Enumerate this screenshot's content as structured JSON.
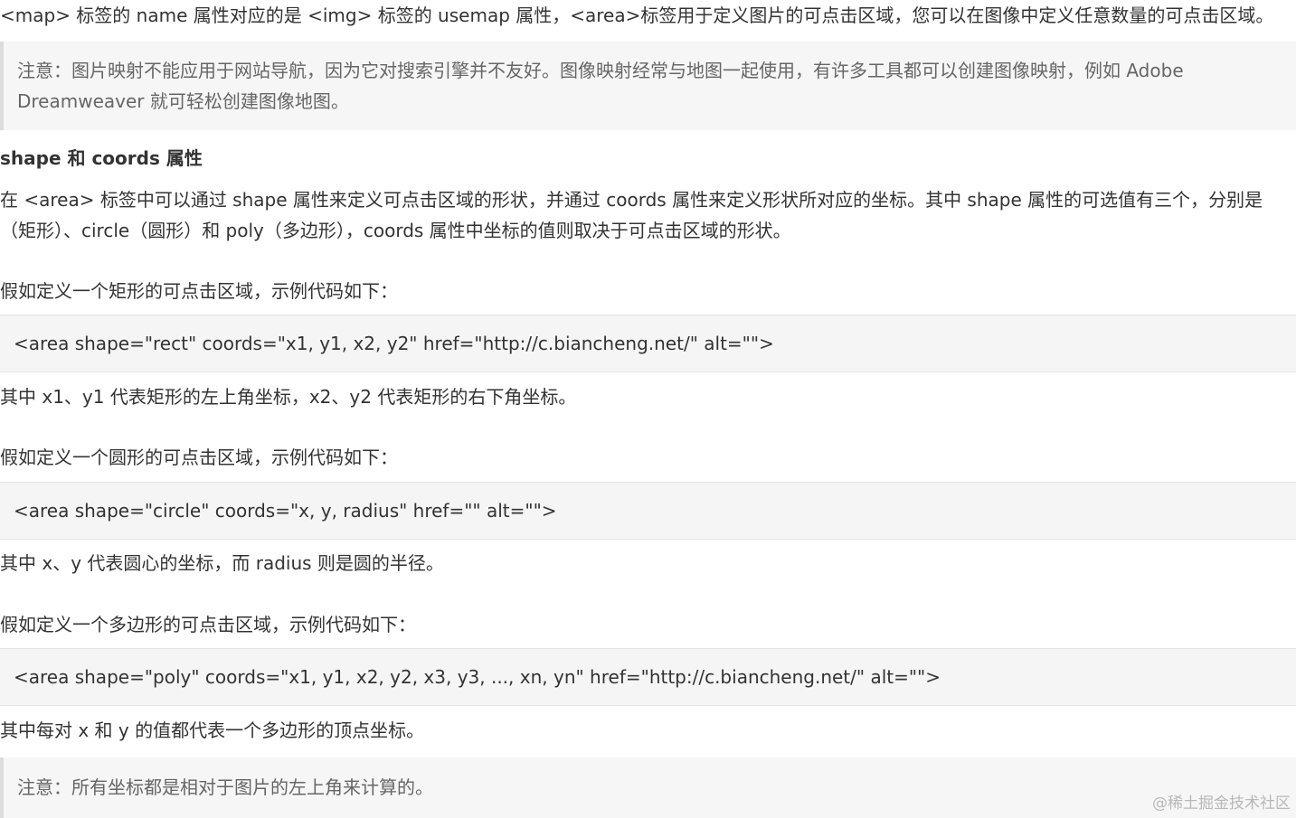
{
  "intro": {
    "line1": "<map> 标签的 name 属性对应的是 <img> 标签的 usemap 属性，<area>标签用于定义图片的可点击区域，您可以在图像中定义任意数量的可点击区域。"
  },
  "note1": {
    "line1": "注意：图片映射不能应用于网站导航，因为它对搜索引擎并不友好。图像映射经常与地图一起使用，有许多工具都可以创建图像映射，例如 Adobe",
    "line2": "Dreamweaver 就可轻松创建图像地图。"
  },
  "section": {
    "heading": "shape 和 coords 属性",
    "para_line1": "在 <area> 标签中可以通过 shape 属性来定义可点击区域的形状，并通过 coords 属性来定义形状所对应的坐标。其中 shape 属性的可选值有三个，分别是",
    "para_line2": "（矩形）、circle（圆形）和 poly（多边形），coords 属性中坐标的值则取决于可点击区域的形状。"
  },
  "rect": {
    "intro": "假如定义一个矩形的可点击区域，示例代码如下：",
    "code": "<area shape=\"rect\" coords=\"x1, y1, x2, y2\" href=\"http://c.biancheng.net/\" alt=\"\">",
    "explain": "其中 x1、y1 代表矩形的左上角坐标，x2、y2 代表矩形的右下角坐标。"
  },
  "circle": {
    "intro": "假如定义一个圆形的可点击区域，示例代码如下：",
    "code": "<area shape=\"circle\" coords=\"x, y, radius\" href=\"\" alt=\"\">",
    "explain": "其中 x、y 代表圆心的坐标，而 radius 则是圆的半径。"
  },
  "poly": {
    "intro": "假如定义一个多边形的可点击区域，示例代码如下：",
    "code": "<area shape=\"poly\" coords=\"x1, y1, x2, y2, x3, y3, ..., xn, yn\" href=\"http://c.biancheng.net/\" alt=\"\">",
    "explain": "其中每对 x 和 y 的值都代表一个多边形的顶点坐标。"
  },
  "note2": {
    "line1": "注意：所有坐标都是相对于图片的左上角来计算的。"
  },
  "watermark": "@稀土掘金技术社区"
}
